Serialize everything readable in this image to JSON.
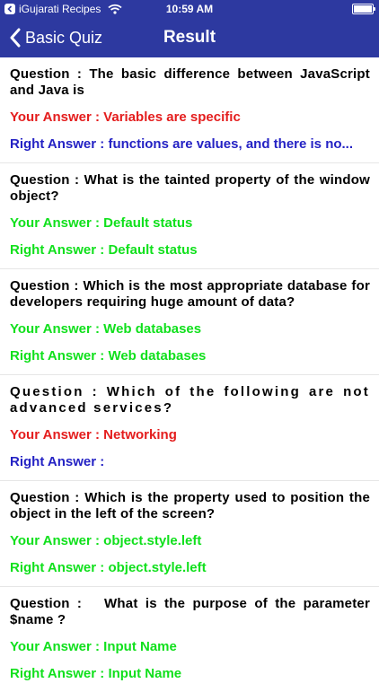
{
  "status": {
    "back_app": "iGujarati Recipes",
    "time": "10:59 AM"
  },
  "nav": {
    "back_label": "Basic Quiz",
    "title": "Result"
  },
  "colors": {
    "header": "#2d39a0",
    "correct": "#10e01c",
    "wrong": "#e41d1d",
    "right_answer": "#2422c4"
  },
  "items": [
    {
      "question": "Question : The basic difference between JavaScript and Java is",
      "your_answer": "Your Answer :  Variables are specific",
      "right_answer": "Right Answer :  functions are values, and there is no..."
    },
    {
      "question": "Question : What is the tainted property of the window object?",
      "your_answer": "Your Answer :  Default status",
      "right_answer": "Right Answer :  Default status"
    },
    {
      "question": "Question : Which is the most appropriate database for developers requiring huge amount of data?",
      "your_answer": "Your Answer :  Web databases",
      "right_answer": "Right Answer : Web databases"
    },
    {
      "question": "Question : Which of the following are not advanced services?",
      "your_answer": "Your Answer :  Networking",
      "right_answer": "Right Answer :"
    },
    {
      "question": "Question : Which is the property used to position the object in the left of the screen?",
      "your_answer": "Your Answer : object.style.left",
      "right_answer": "Right Answer :  object.style.left"
    },
    {
      "question": "Question :   What is the purpose of the parameter $name ?",
      "your_answer": "Your Answer :  Input Name",
      "right_answer": "Right Answer :  Input Name"
    }
  ]
}
